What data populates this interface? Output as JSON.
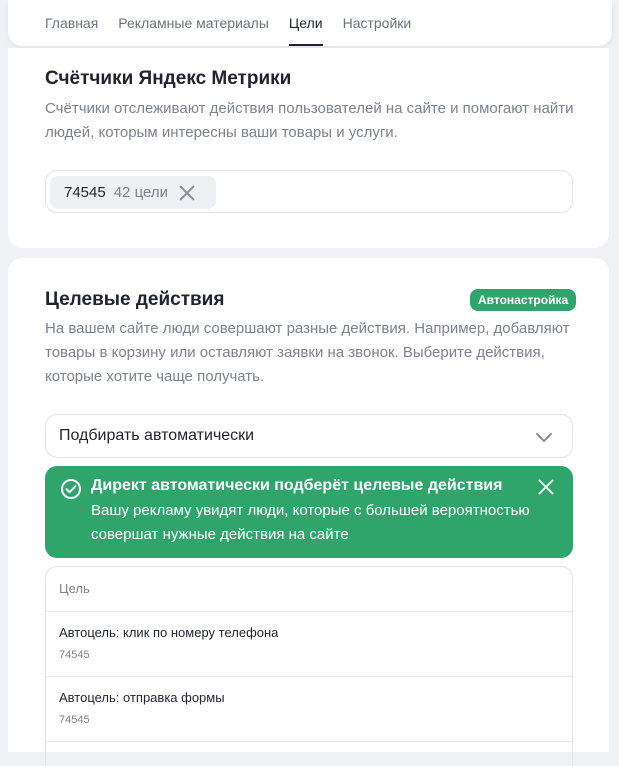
{
  "nav": {
    "tabs": [
      {
        "label": "Главная"
      },
      {
        "label": "Рекламные материалы"
      },
      {
        "label": "Цели"
      },
      {
        "label": "Настройки"
      }
    ],
    "active_tab": "Цели"
  },
  "counters": {
    "title": "Счётчики Яндекс Метрики",
    "description": "Счётчики отслеживают действия пользователей на сайте и помогают найти людей, которым интересны ваши товары и услуги.",
    "chip": {
      "number": "74545",
      "goals": "42 цели"
    }
  },
  "goals": {
    "title": "Целевые действия",
    "badge": "Автонастройка",
    "description": "На вашем сайте люди совершают разные действия. Например, добавляют товары в корзину или оставляют заявки на звонок. Выберите действия, которые хотите чаще получать.",
    "select_value": "Подбирать автоматически",
    "alert": {
      "title": "Директ автоматически подберёт целевые действия",
      "text": "Вашу рекламу увидят люди, которые с большей вероятностью совершат нужные действия на сайте"
    },
    "table": {
      "header": "Цель",
      "rows": [
        {
          "name": "Автоцель: клик по номеру телефона",
          "counter": "74545"
        },
        {
          "name": "Автоцель: отправка формы",
          "counter": "74545"
        }
      ]
    }
  },
  "colors": {
    "accent_green": "#2fa56b",
    "text_primary": "#1f2330",
    "text_secondary": "#7b8290"
  }
}
